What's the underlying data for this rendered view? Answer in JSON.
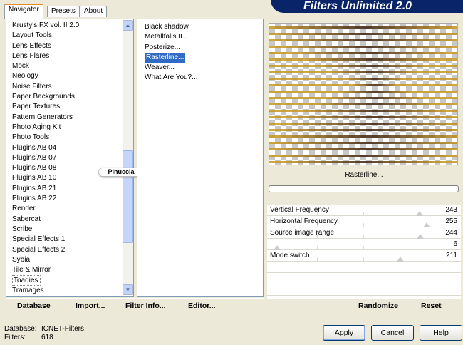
{
  "tabs": [
    {
      "label": "Navigator",
      "active": true
    },
    {
      "label": "Presets",
      "active": false
    },
    {
      "label": "About",
      "active": false
    }
  ],
  "banner": {
    "title": "Filters Unlimited 2.0"
  },
  "categories": {
    "items": [
      "Krusty's FX vol. II 2.0",
      "Layout Tools",
      "Lens Effects",
      "Lens Flares",
      "Mock",
      "Neology",
      "Noise Filters",
      "Paper Backgrounds",
      "Paper Textures",
      "Pattern Generators",
      "Photo Aging Kit",
      "Photo Tools",
      "Plugins AB 04",
      "Plugins AB 07",
      "Plugins AB 08",
      "Plugins AB 10",
      "Plugins AB 21",
      "Plugins AB 22",
      "Render",
      "Sabercat",
      "Scribe",
      "Special Effects 1",
      "Special Effects 2",
      "Sybia",
      "Tile & Mirror",
      "Toadies",
      "Tramages"
    ],
    "selected": "Toadies"
  },
  "filters": {
    "items": [
      "Black shadow",
      "Metallfalls II...",
      "Posterize...",
      "Rasterline...",
      "Weaver...",
      "What Are You?..."
    ],
    "selected": "Rasterline..."
  },
  "watermark": {
    "text": "Pinuccia"
  },
  "preview": {
    "filter_name": "Rasterline...",
    "progress": 0,
    "stripe_color": "#c8961e",
    "dark_color": "#3a1f0c"
  },
  "params": [
    {
      "label": "Vertical Frequency",
      "value": "243",
      "level": 0.953
    },
    {
      "label": "Horizontal Frequency",
      "value": "255",
      "level": 1.0
    },
    {
      "label": "Source image range",
      "value": "244",
      "level": 0.957
    },
    {
      "label": "",
      "value": "6",
      "level": 0.024
    },
    {
      "label": "Mode switch",
      "value": "211",
      "level": 0.827
    }
  ],
  "bottom_buttons": {
    "database": "Database",
    "import": "Import...",
    "filter_info": "Filter Info...",
    "editor": "Editor...",
    "randomize": "Randomize",
    "reset": "Reset"
  },
  "status": {
    "database_label": "Database:",
    "database_value": "ICNET-Filters",
    "filters_label": "Filters:",
    "filters_value": "618"
  },
  "dialog_buttons": {
    "apply": "Apply",
    "cancel": "Cancel",
    "help": "Help"
  },
  "icons": {
    "scroll_up": "chevron-up-icon",
    "scroll_down": "chevron-down-icon"
  }
}
